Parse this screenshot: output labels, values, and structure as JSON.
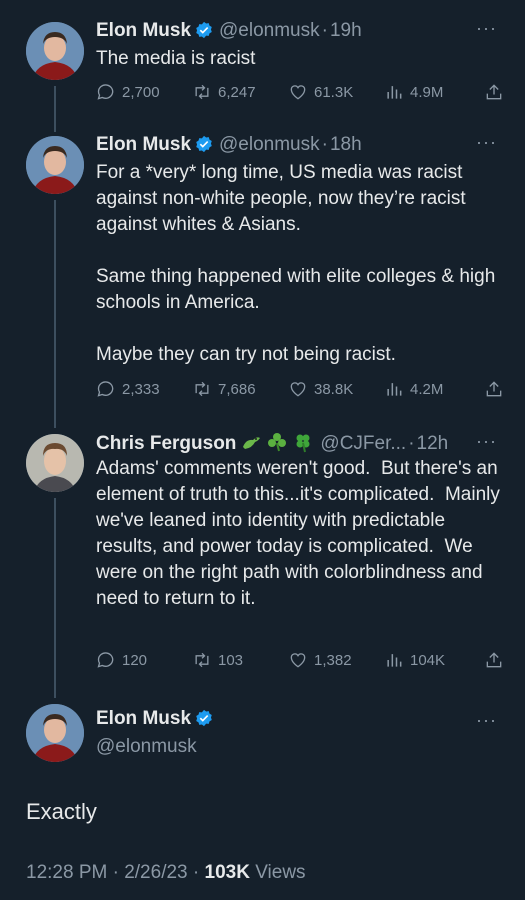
{
  "tweets": [
    {
      "name": "Elon Musk",
      "handle": "@elonmusk",
      "time": "19h",
      "text": "The media is racist",
      "stats": {
        "replies": "2,700",
        "retweets": "6,247",
        "likes": "61.3K",
        "views": "4.9M"
      }
    },
    {
      "name": "Elon Musk",
      "handle": "@elonmusk",
      "time": "18h",
      "text": "For a *very* long time, US media was racist against non-white people, now they’re racist against whites & Asians.\n\nSame thing happened with elite colleges & high schools in America.\n\nMaybe they can try not being racist.",
      "stats": {
        "replies": "2,333",
        "retweets": "7,686",
        "likes": "38.8K",
        "views": "4.2M"
      }
    },
    {
      "name": "Chris Ferguson",
      "handle": "@CJFer...",
      "time": "12h",
      "text": "Adams' comments weren't good.  But there's an element of truth to this...it's complicated.  Mainly we've leaned into identity with predictable results, and power today is complicated.  We were on the right path with colorblindness and need to return to it.",
      "stats": {
        "replies": "120",
        "retweets": "103",
        "likes": "1,382",
        "views": "104K"
      }
    }
  ],
  "main": {
    "name": "Elon Musk",
    "handle": "@elonmusk",
    "text": "Exactly",
    "timestamp": "12:28 PM · 2/26/23 · ",
    "views_count": "103K",
    "views_label": " Views"
  },
  "colors": {
    "background": "#15202b",
    "text": "#e7e9ea",
    "muted": "#8b98a5",
    "verified": "#1d9bf0"
  },
  "icons": [
    "verified-badge-icon",
    "reply-icon",
    "retweet-icon",
    "like-icon",
    "views-icon",
    "share-icon",
    "more-icon",
    "dragon-emoji-icon",
    "shamrock-emoji-icon",
    "four-leaf-clover-emoji-icon"
  ]
}
